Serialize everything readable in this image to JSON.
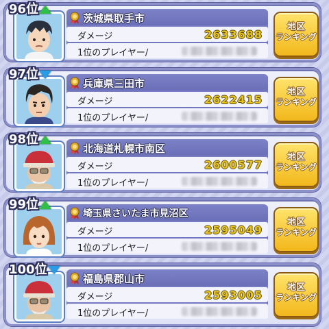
{
  "labels": {
    "damage": "ダメージ",
    "top_player": "1位のプレイヤー/",
    "button_line1": "地区",
    "button_line2": "ランキング"
  },
  "colors": {
    "up_arrow": "#2fbf46",
    "down_arrow": "#2a9be6",
    "damage_text": "#e7c322",
    "button": "#f2b81c"
  },
  "entries": [
    {
      "rank": "96位",
      "trend": "up",
      "region": "茨城県取手市",
      "damage": "2633688",
      "character": "boy-short-hair"
    },
    {
      "rank": "97位",
      "trend": "down",
      "region": "兵庫県三田市",
      "damage": "2622415",
      "character": "man-dark-hair"
    },
    {
      "rank": "98位",
      "trend": "up",
      "region": "北海道札幌市南区",
      "damage": "2600577",
      "character": "old-man-red-hat"
    },
    {
      "rank": "99位",
      "trend": "up",
      "region": "埼玉県さいたま市見沼区",
      "damage": "2595049",
      "character": "girl-brown-hair"
    },
    {
      "rank": "100位",
      "trend": "down",
      "region": "福島県郡山市",
      "damage": "2593005",
      "character": "old-man-red-hat"
    }
  ]
}
